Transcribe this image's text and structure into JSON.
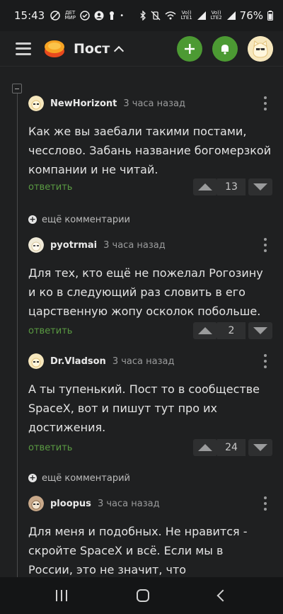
{
  "status_bar": {
    "time": "15:43",
    "tiny_icon_text": "ДЕТ МИР",
    "lte1": "Vo)) LTE1",
    "lte2": "Vo)) LTE2",
    "battery": "76%"
  },
  "header": {
    "title": "Пост",
    "icons": [
      "menu-icon",
      "pikabu-logo",
      "chevron-up-icon",
      "plus-icon",
      "bell-icon",
      "user-avatar"
    ],
    "accent_color": "#4c9a33"
  },
  "comments": [
    {
      "username": "NewHorizont",
      "time": "3 часа назад",
      "text": "Как же вы заебали такими постами, чесслово. Забань название богомерзкой компании и не читай.",
      "reply_label": "ответить",
      "rating": "13"
    },
    {
      "username": "pyotrmai",
      "time": "3 часа назад",
      "text": "Для тех, кто ещё не пожелал Рогозину и ко в следующий раз словить в его царственную жопу осколок побольше.",
      "reply_label": "ответить",
      "rating": "2"
    },
    {
      "username": "Dr.Vladson",
      "time": "3 часа назад",
      "text": "А ты тупенький. Пост то в сообществе SpaceX, вот и пишут тут про их достижения.",
      "reply_label": "ответить",
      "rating": "24"
    },
    {
      "username": "ploopus",
      "time": "3 часа назад",
      "text": "Для меня и подобных. Не нравится - скройте SpaceX и всё. Если мы в России, это не значит, что",
      "reply_label": "",
      "rating": ""
    }
  ],
  "more_comments": [
    {
      "label": "ещё комментарии"
    },
    {
      "label": "ещё комментарий"
    }
  ]
}
